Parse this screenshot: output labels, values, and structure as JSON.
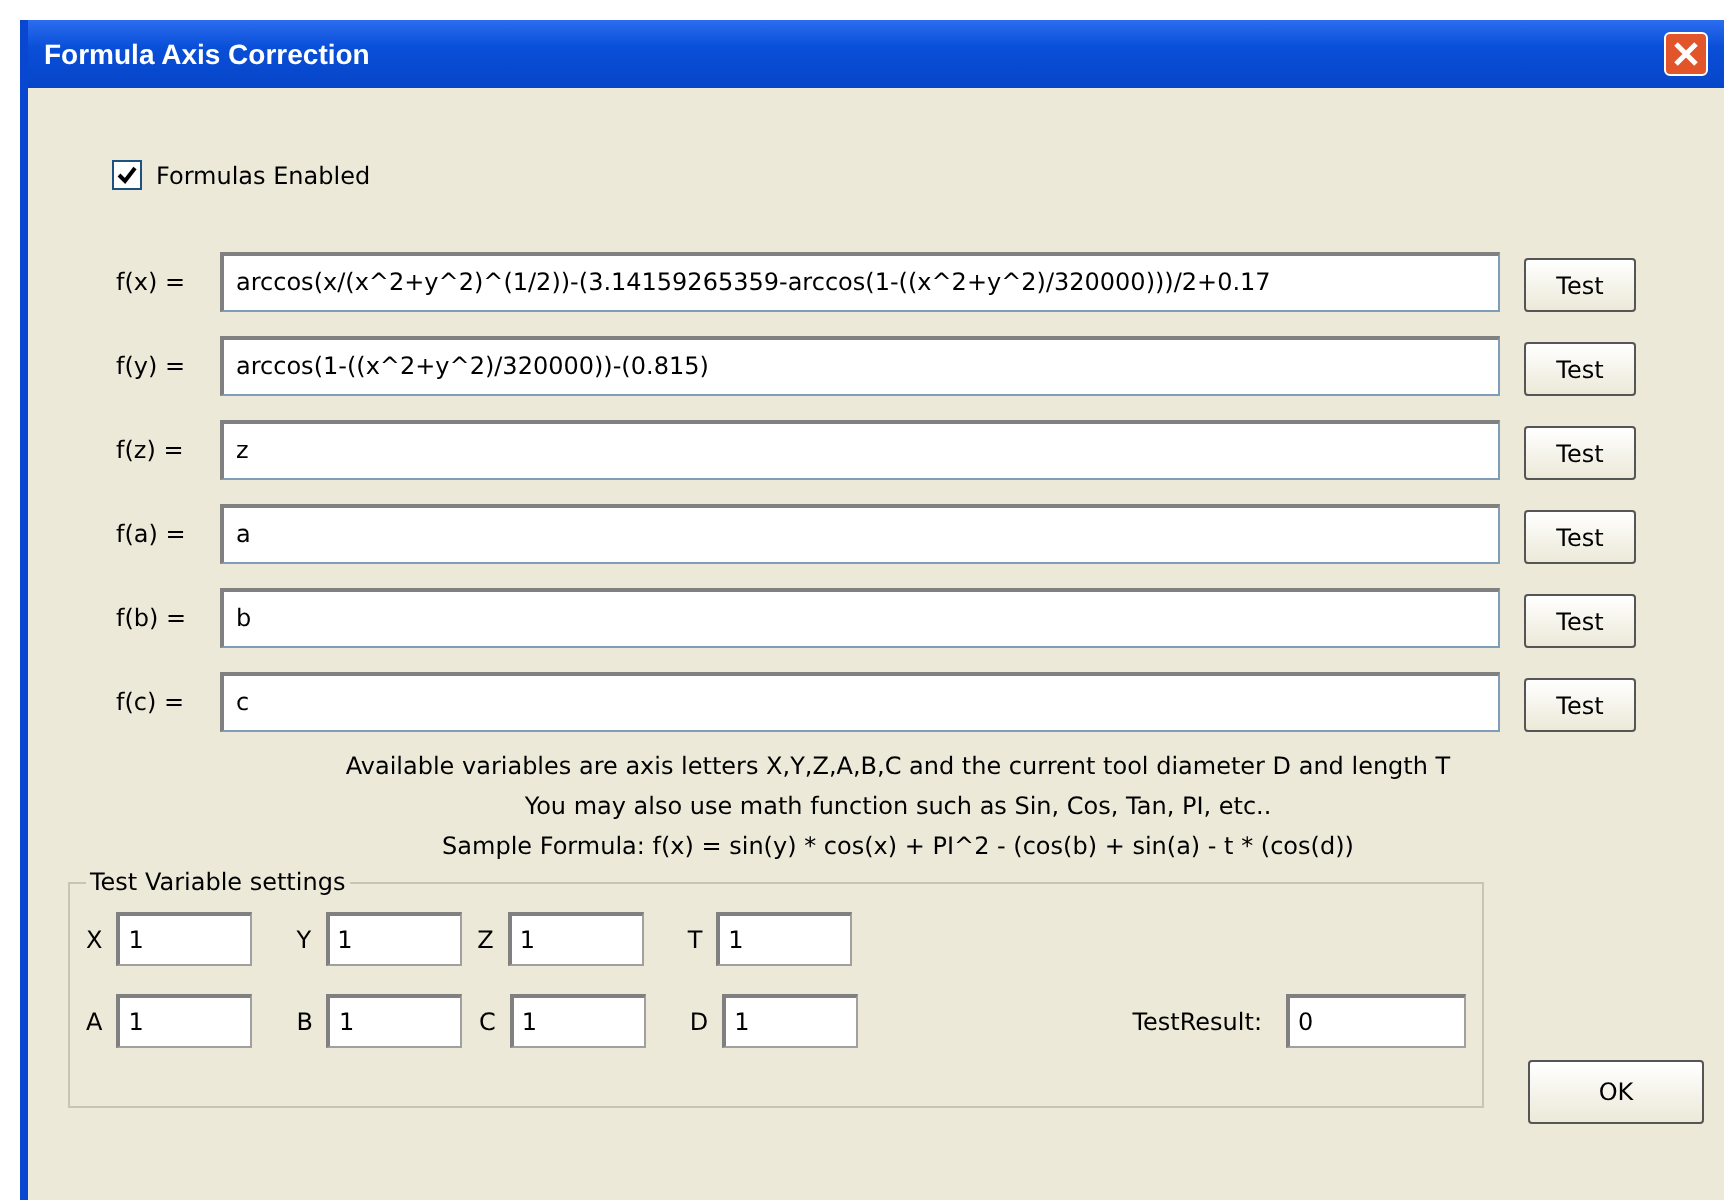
{
  "window": {
    "title": "Formula Axis Correction"
  },
  "formulas_enabled": {
    "label": "Formulas Enabled",
    "checked": true
  },
  "formulas": [
    {
      "label": "f(x) =",
      "value": "arccos(x/(x^2+y^2)^(1/2))-(3.14159265359-arccos(1-((x^2+y^2)/320000)))/2+0.17",
      "button": "Test"
    },
    {
      "label": "f(y) =",
      "value": "arccos(1-((x^2+y^2)/320000))-(0.815)",
      "button": "Test"
    },
    {
      "label": "f(z) =",
      "value": "z",
      "button": "Test"
    },
    {
      "label": "f(a) =",
      "value": "a",
      "button": "Test"
    },
    {
      "label": "f(b) =",
      "value": "b",
      "button": "Test"
    },
    {
      "label": "f(c) =",
      "value": "c",
      "button": "Test"
    }
  ],
  "notes": [
    "Available variables are axis letters X,Y,Z,A,B,C and the current tool diameter D and length T",
    "You may also use math function such as Sin, Cos, Tan, PI, etc..",
    "Sample Formula: f(x) =  sin(y) * cos(x) + PI^2 - (cos(b) + sin(a) - t * (cos(d))"
  ],
  "test_variables": {
    "title": "Test Variable settings",
    "rows": [
      [
        {
          "label": "X",
          "value": "1"
        },
        {
          "label": "Y",
          "value": "1"
        },
        {
          "label": "Z",
          "value": "1"
        },
        {
          "label": "T",
          "value": "1"
        }
      ],
      [
        {
          "label": "A",
          "value": "1"
        },
        {
          "label": "B",
          "value": "1"
        },
        {
          "label": "C",
          "value": "1"
        },
        {
          "label": "D",
          "value": "1"
        }
      ]
    ],
    "result": {
      "label": "TestResult:",
      "value": "0"
    }
  },
  "buttons": [
    "OK"
  ]
}
